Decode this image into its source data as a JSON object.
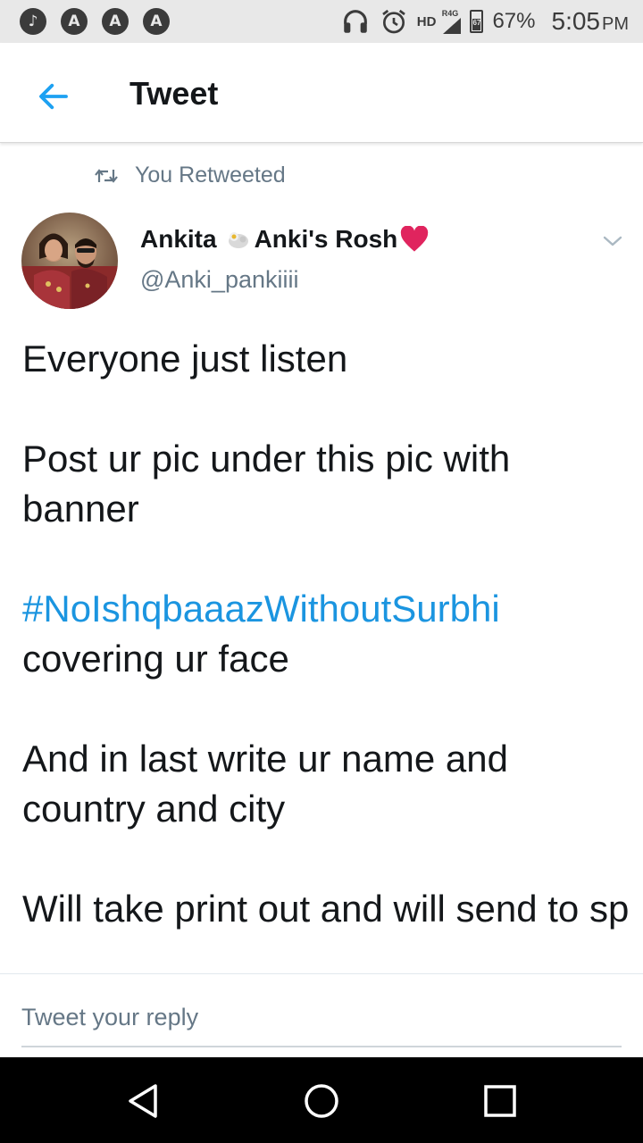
{
  "status_bar": {
    "left_icons": [
      "music-note-icon",
      "app-notification-icon",
      "app-notification-icon",
      "app-notification-icon"
    ],
    "hd_label": "HD",
    "network_label": "R4G",
    "battery_level": "67",
    "battery_percent": "67%",
    "time": "5:05",
    "ampm": "PM"
  },
  "header": {
    "title": "Tweet"
  },
  "retweet_context": {
    "label": "You Retweeted"
  },
  "tweet": {
    "author_name_first": "Ankita",
    "author_name_second": "Anki's Rosh",
    "author_handle": "@Anki_pankiiii",
    "body": {
      "line1": "Everyone just listen",
      "line2": "Post ur pic under this pic with banner",
      "hashtag": "#NoIshqbaaazWithoutSurbhi",
      "line3_rest": "covering ur face",
      "line4": "And in last write ur name and country and city",
      "line5": "Will take print out and will send to sp"
    }
  },
  "reply": {
    "placeholder": "Tweet your reply"
  },
  "colors": {
    "accent": "#1da1f2",
    "hashtag": "#1b95e0",
    "secondary_text": "#657786",
    "heart": "#e0245e"
  }
}
